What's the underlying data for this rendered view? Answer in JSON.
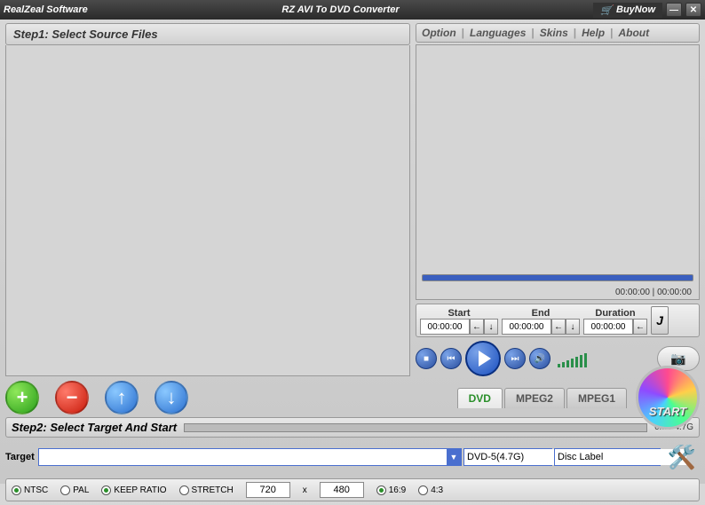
{
  "titlebar": {
    "company": "RealZeal Software",
    "app": "RZ AVI To DVD Converter",
    "buynow": "BuyNow"
  },
  "menu": {
    "option": "Option",
    "languages": "Languages",
    "skins": "Skins",
    "help": "Help",
    "about": "About"
  },
  "step1": {
    "title": "Step1: Select Source Files"
  },
  "preview": {
    "time_current": "00:00:00",
    "time_total": "00:00:00"
  },
  "trim": {
    "start_lbl": "Start",
    "start_val": "00:00:00",
    "end_lbl": "End",
    "end_val": "00:00:00",
    "dur_lbl": "Duration",
    "dur_val": "00:00:00"
  },
  "tabs": {
    "dvd": "DVD",
    "mpeg2": "MPEG2",
    "mpeg1": "MPEG1"
  },
  "start_label": "START",
  "step2": {
    "title": "Step2: Select Target And Start",
    "size": "0M / 4.7G"
  },
  "target": {
    "label": "Target",
    "path": "",
    "disc": "DVD-5(4.7G)",
    "disclabel": "Disc Label"
  },
  "settings": {
    "ntsc": "NTSC",
    "pal": "PAL",
    "keep": "KEEP RATIO",
    "stretch": "STRETCH",
    "width": "720",
    "x": "x",
    "height": "480",
    "r169": "16:9",
    "r43": "4:3"
  }
}
